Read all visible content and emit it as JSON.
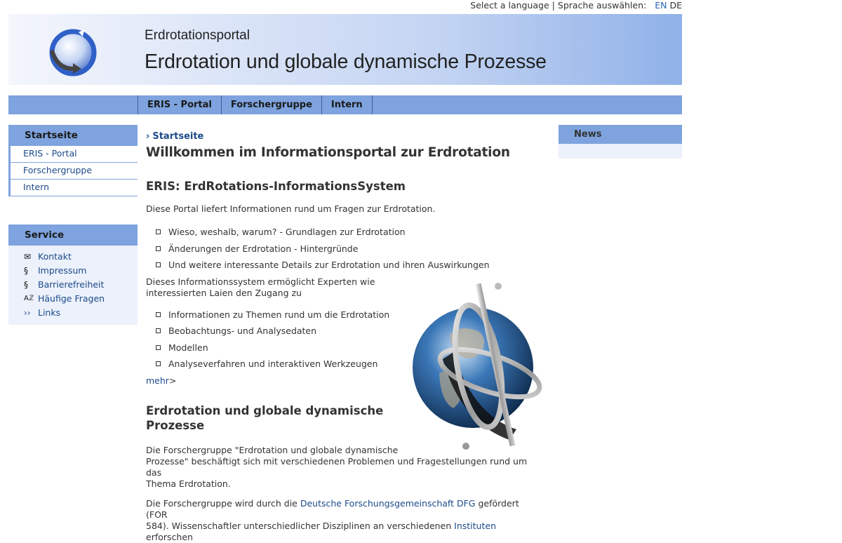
{
  "lang_bar": {
    "select_en": "Select a language",
    "separator": "|",
    "select_de": "Sprache auswählen:",
    "lang_en": "EN",
    "lang_de": "DE"
  },
  "banner": {
    "site_name": "Erdrotationsportal",
    "site_title": "Erdrotation und globale dynamische Prozesse"
  },
  "topnav": {
    "items": [
      "ERIS - Portal",
      "Forschergruppe",
      "Intern"
    ]
  },
  "left_nav": {
    "heading": "Startseite",
    "items": [
      "ERIS - Portal",
      "Forschergruppe",
      "Intern"
    ]
  },
  "service": {
    "heading": "Service",
    "items": [
      {
        "icon": "envelope-icon",
        "glyph": "✉",
        "label": "Kontakt"
      },
      {
        "icon": "section-icon",
        "glyph": "§",
        "label": "Impressum"
      },
      {
        "icon": "section-icon",
        "glyph": "§",
        "label": "Barrierefreiheit"
      },
      {
        "icon": "az-icon",
        "glyph": "Aℤ",
        "label": "Häufige Fragen"
      },
      {
        "icon": "double-chevron-icon",
        "glyph": "››",
        "label": "Links"
      }
    ]
  },
  "main": {
    "breadcrumb": "Startseite",
    "title": "Willkommen im Informationsportal zur Erdrotation",
    "section1_heading": "ERIS: ErdRotations-InformationsSystem",
    "section1_intro": "Diese Portal liefert Informationen rund um Fragen zur Erdrotation.",
    "list1": [
      "Wieso, weshalb, warum? - Grundlagen zur Erdrotation",
      "Änderungen der Erdrotation - Hintergründe",
      "Und weitere interessante Details zur Erdrotation und ihren Auswirkungen"
    ],
    "section1_para2_line1": "Dieses Informationssystem ermöglicht Experten wie",
    "section1_para2_line2": "interessierten Laien den Zugang zu",
    "list2": [
      "Informationen zu Themen rund um die Erdrotation",
      "Beobachtungs- und Analysedaten",
      "Modellen",
      "Analyseverfahren und interaktiven Werkzeugen"
    ],
    "more_link": "mehr",
    "more_arrow": ">",
    "section2_heading_line1": "Erdrotation und globale dynamische",
    "section2_heading_line2": "Prozesse",
    "section2_para1_line1": "Die Forschergruppe \"Erdrotation und globale dynamische",
    "section2_para1_line2": "Prozesse\" beschäftigt sich mit verschiedenen Problemen und Fragestellungen rund um das",
    "section2_para1_line3": "Thema Erdrotation.",
    "section2_para2_a": "Die Forschergruppe wird durch die ",
    "section2_para2_link": "Deutsche Forschungsgemeinschaft DFG",
    "section2_para2_b": " gefördert (FOR",
    "section2_para2_c": "584). Wissenschaftler unterschiedlicher Disziplinen an verschiedenen ",
    "section2_para2_link2": "Instituten",
    "section2_para2_d": " erforschen"
  },
  "news": {
    "heading": "News"
  },
  "colors": {
    "nav_blue": "#7ea3de",
    "link_blue": "#1c4a8a",
    "panel_bg": "#ecf1fb"
  }
}
